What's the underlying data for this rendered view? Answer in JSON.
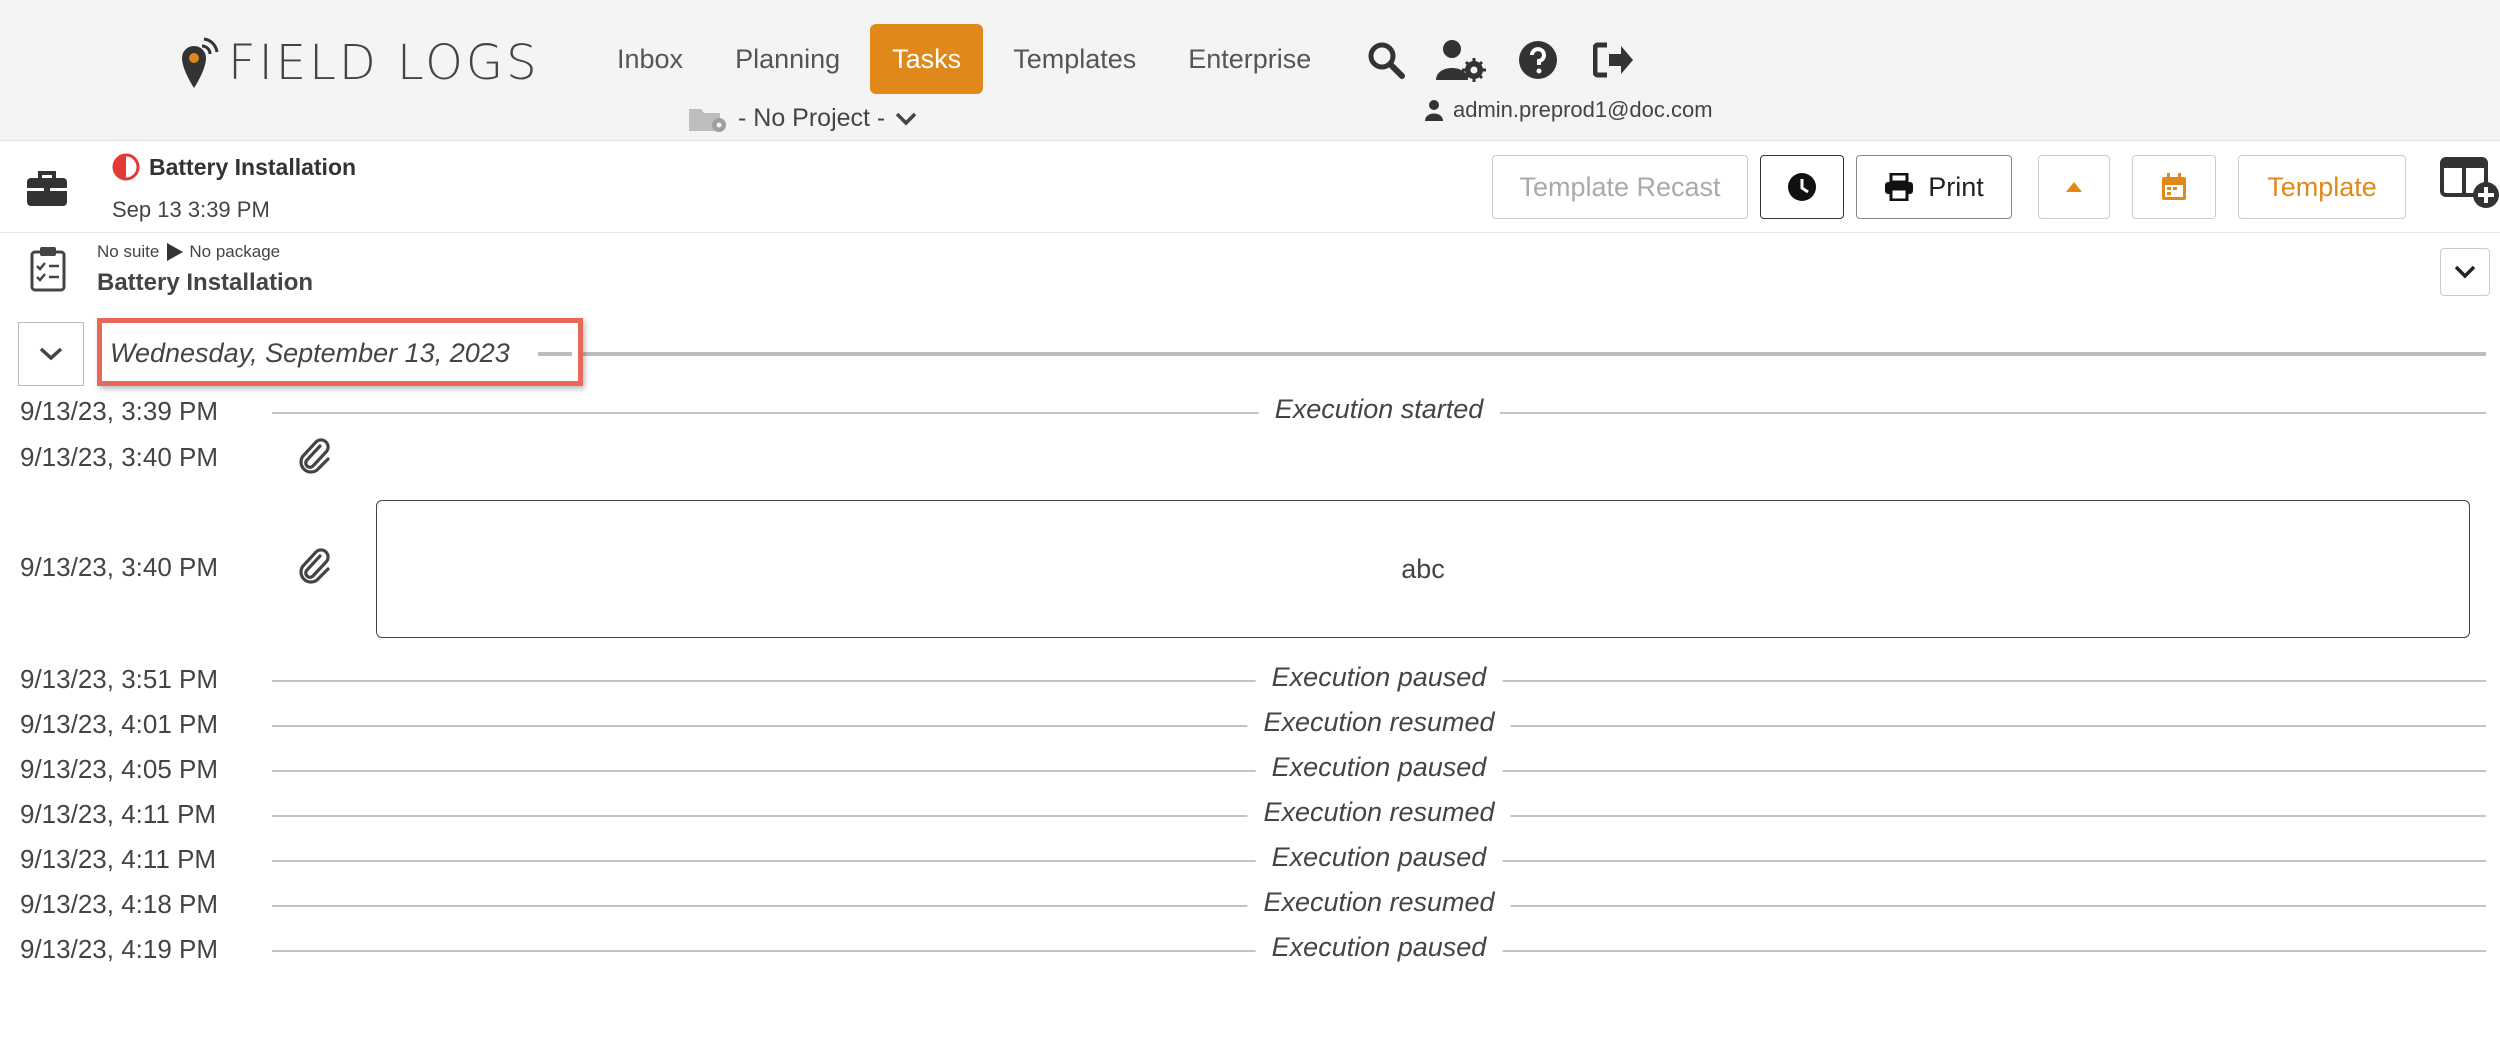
{
  "app": {
    "logo_text": "FIELD LOGS"
  },
  "nav": {
    "items": [
      {
        "label": "Inbox"
      },
      {
        "label": "Planning"
      },
      {
        "label": "Tasks"
      },
      {
        "label": "Templates"
      },
      {
        "label": "Enterprise"
      }
    ],
    "active": "Tasks",
    "accent_color": "#e0891a"
  },
  "project": {
    "label": "- No Project -"
  },
  "header_icons": [
    "search-icon",
    "user-settings-icon",
    "help-icon",
    "logout-icon"
  ],
  "user": {
    "email": "admin.preprod1@doc.com"
  },
  "task": {
    "title": "Battery Installation",
    "timestamp": "Sep 13 3:39 PM",
    "status_color": "#e53935"
  },
  "toolbar": {
    "recast_label": "Template Recast",
    "print_label": "Print",
    "template_label": "Template"
  },
  "breadcrumb": {
    "suite": "No suite",
    "package": "No package",
    "title": "Battery Installation"
  },
  "date_header": {
    "label": "Wednesday, September 13, 2023"
  },
  "timeline": [
    {
      "time": "9/13/23, 3:39 PM",
      "event": "Execution started"
    },
    {
      "time": "9/13/23, 3:40 PM",
      "event": "",
      "attachment": true
    },
    {
      "time": "9/13/23, 3:40 PM",
      "event": "",
      "attachment": true,
      "note": "abc"
    },
    {
      "time": "9/13/23, 3:51 PM",
      "event": "Execution paused"
    },
    {
      "time": "9/13/23, 4:01 PM",
      "event": "Execution resumed"
    },
    {
      "time": "9/13/23, 4:05 PM",
      "event": "Execution paused"
    },
    {
      "time": "9/13/23, 4:11 PM",
      "event": "Execution resumed"
    },
    {
      "time": "9/13/23, 4:11 PM",
      "event": "Execution paused"
    },
    {
      "time": "9/13/23, 4:18 PM",
      "event": "Execution resumed"
    },
    {
      "time": "9/13/23, 4:19 PM",
      "event": "Execution paused"
    }
  ]
}
